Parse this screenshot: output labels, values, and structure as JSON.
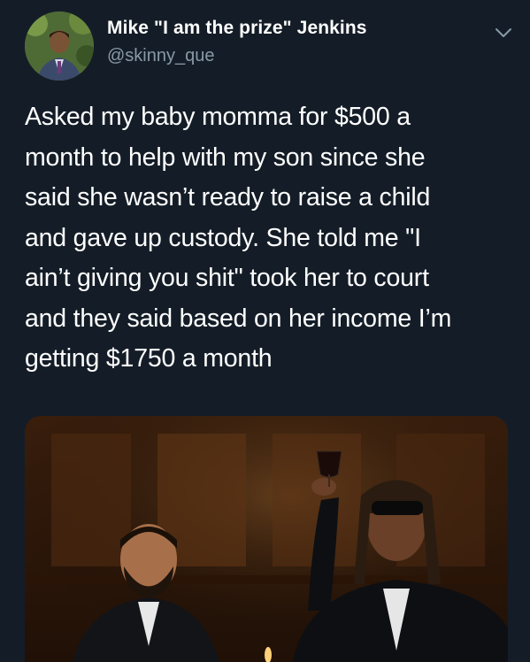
{
  "author": {
    "display_name": "Mike \"I am the prize\" Jenkins",
    "handle": "@skinny_que",
    "avatar_icon": "profile-photo"
  },
  "menu": {
    "icon": "chevron-down-icon"
  },
  "tweet": {
    "text_lines": [
      "Asked my baby momma for $500 a",
      "month to help with my son since she",
      "said she wasn’t ready to raise a child",
      "and gave up custody. She told me \"I",
      "ain’t giving you shit\" took her to court",
      "and they said based on her income I’m",
      "getting $1750 a month"
    ]
  },
  "media": {
    "description_icon": "meme-photo"
  },
  "colors": {
    "background": "#141d27",
    "text": "#ffffff",
    "secondary_text": "#8899a6"
  }
}
